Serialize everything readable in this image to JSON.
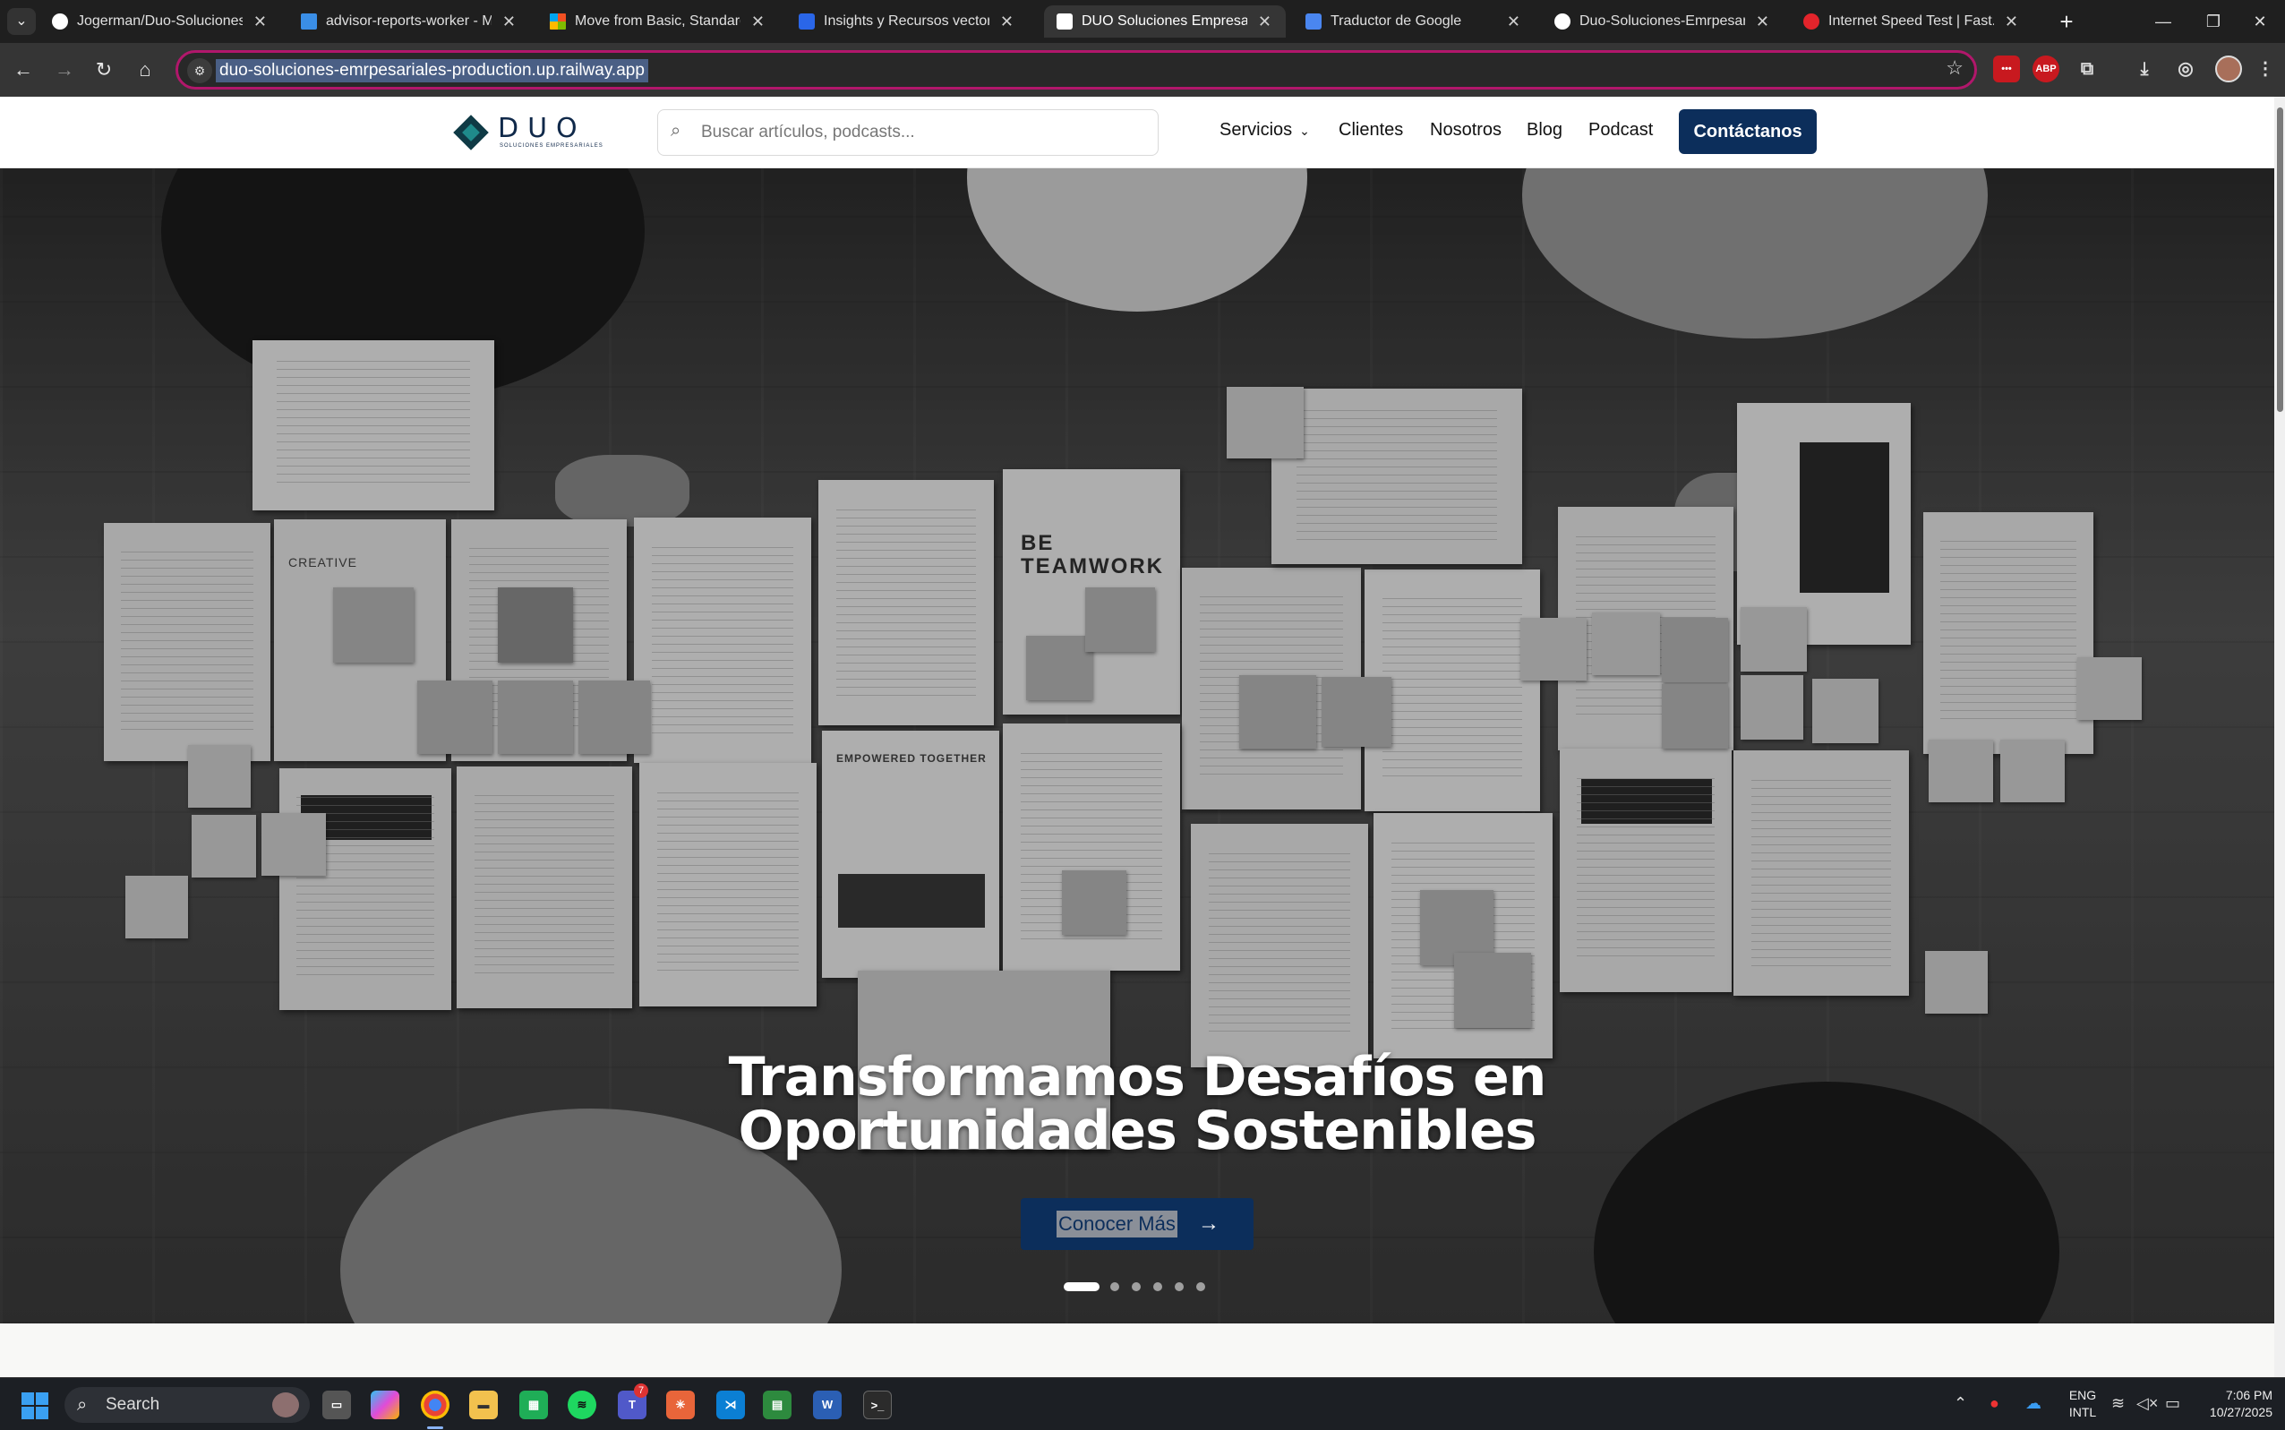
{
  "browser": {
    "tabs": [
      {
        "title": "Jogerman/Duo-Soluciones-E",
        "icon": "github-icon",
        "color": "#ffffff"
      },
      {
        "title": "advisor-reports-worker - Mic",
        "icon": "azure-icon",
        "color": "#3a8ee6"
      },
      {
        "title": "Move from Basic, Standard, F",
        "icon": "microsoft-icon",
        "color": "#f25022"
      },
      {
        "title": "Insights y Recursos vectors, p",
        "icon": "freepik-icon",
        "color": "#2a66e8"
      },
      {
        "title": "DUO Soluciones Empresariale",
        "icon": "duo-icon",
        "color": "#ffffff",
        "active": true
      },
      {
        "title": "Traductor de Google",
        "icon": "google-translate-icon",
        "color": "#4a86f0"
      },
      {
        "title": "Duo-Soluciones-Emrpesarial",
        "icon": "github-icon",
        "color": "#ffffff"
      },
      {
        "title": "Internet Speed Test | Fast.com",
        "icon": "fast-icon",
        "color": "#e3242b"
      }
    ],
    "address": "duo-soluciones-emrpesariales-production.up.railway.app",
    "extensions": {
      "ext1": "•••",
      "abp": "ABP"
    }
  },
  "site": {
    "logo": {
      "text": "DUO",
      "sub": "SOLUCIONES EMPRESARIALES"
    },
    "search": {
      "placeholder": "Buscar artículos, podcasts..."
    },
    "nav": {
      "servicios": "Servicios",
      "clientes": "Clientes",
      "nosotros": "Nosotros",
      "blog": "Blog",
      "podcast": "Podcast",
      "cta": "Contáctanos"
    },
    "hero": {
      "title_line1": "Transformamos Desafíos en",
      "title_line2": "Oportunidades Sostenibles",
      "button": "Conocer Más",
      "slides": 6,
      "active_slide": 1,
      "photo_text": {
        "creative": "CREATIVE",
        "teamwork": "BE\nTEAMWORK",
        "empowered": "EMPOWERED TOGETHER"
      }
    },
    "colors": {
      "primary": "#0c2e5b",
      "logo": "#10294a"
    }
  },
  "taskbar": {
    "search": "Search",
    "teams_badge": "7",
    "lang": {
      "line1": "ENG",
      "line2": "INTL"
    },
    "time": "7:06 PM",
    "date": "10/27/2025"
  }
}
